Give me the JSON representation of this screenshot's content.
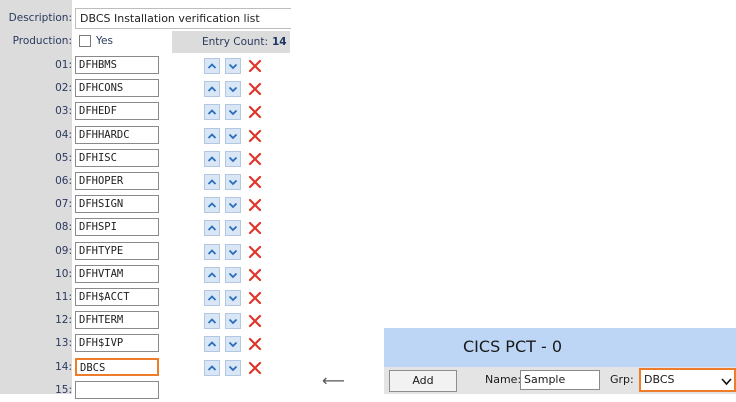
{
  "form": {
    "description_label": "Description:",
    "description_value": "DBCS Installation verification list",
    "production_label": "Production:",
    "production_checked": false,
    "production_option": "Yes",
    "entry_count_label": "Entry Count:",
    "entry_count_value": "14"
  },
  "entries": [
    {
      "num": "01:",
      "value": "DFHBMS"
    },
    {
      "num": "02:",
      "value": "DFHCONS"
    },
    {
      "num": "03:",
      "value": "DFHEDF"
    },
    {
      "num": "04:",
      "value": "DFHHARDC"
    },
    {
      "num": "05:",
      "value": "DFHISC"
    },
    {
      "num": "06:",
      "value": "DFHOPER"
    },
    {
      "num": "07:",
      "value": "DFHSIGN"
    },
    {
      "num": "08:",
      "value": "DFHSPI"
    },
    {
      "num": "09:",
      "value": "DFHTYPE"
    },
    {
      "num": "10:",
      "value": "DFHVTAM"
    },
    {
      "num": "11:",
      "value": "DFH$ACCT"
    },
    {
      "num": "12:",
      "value": "DFHTERM"
    },
    {
      "num": "13:",
      "value": "DFH$IVP"
    },
    {
      "num": "14:",
      "value": "DBCS"
    },
    {
      "num": "15:",
      "value": ""
    }
  ],
  "arrow": "⟵",
  "pct": {
    "title": "CICS PCT - 0",
    "add_label": "Add",
    "name_label": "Name:",
    "name_value": "Sample",
    "grp_label": "Grp:",
    "grp_value": "DBCS"
  },
  "colors": {
    "highlight": "#ee7d2b",
    "header_blue": "#bed6f5",
    "delete_red": "#e0352b"
  }
}
